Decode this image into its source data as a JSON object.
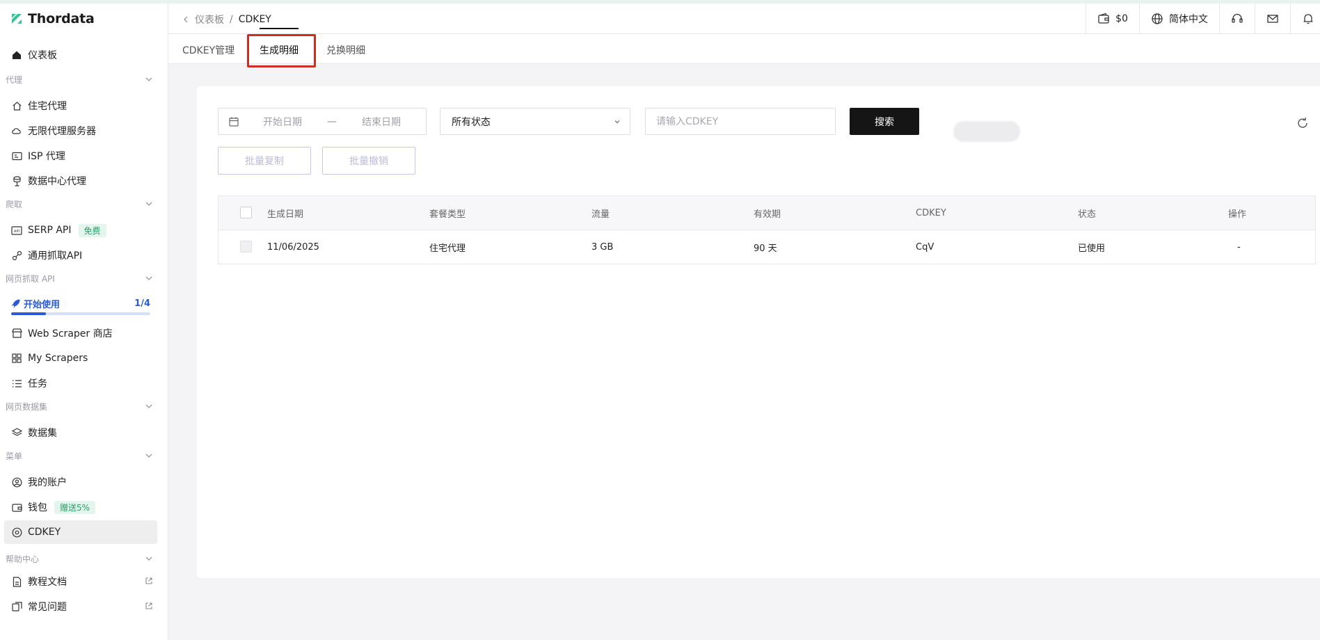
{
  "brand": {
    "name": "Thordata"
  },
  "sidebar": {
    "dashboard": "仪表板",
    "sections": {
      "proxy": "代理",
      "scrape": "爬取",
      "web_scraping_api": "网页抓取 API",
      "web_datasets": "网页数据集",
      "menu": "菜单",
      "help": "帮助中心"
    },
    "items": {
      "residential": "住宅代理",
      "unlimited": "无限代理服务器",
      "isp": "ISP 代理",
      "datacenter": "数据中心代理",
      "serp": "SERP API",
      "serp_badge": "免费",
      "universal": "通用抓取API",
      "store": "Web Scraper 商店",
      "my_scrapers": "My Scrapers",
      "tasks": "任务",
      "dataset": "数据集",
      "account": "我的账户",
      "wallet": "钱包",
      "wallet_badge": "赠送5%",
      "cdkey": "CDKEY",
      "docs": "教程文档",
      "faq": "常见问题"
    },
    "getting_started": {
      "label": "开始使用",
      "progress_text": "1/4",
      "progress": 0.25
    }
  },
  "header": {
    "breadcrumb": [
      "仪表板",
      "CDKEY"
    ],
    "balance": "$0",
    "language": "简体中文"
  },
  "tabs": [
    "CDKEY管理",
    "生成明细",
    "兑换明细"
  ],
  "active_tab": 1,
  "filters": {
    "start_placeholder": "开始日期",
    "separator": "—",
    "end_placeholder": "结束日期",
    "status_selected": "所有状态",
    "cdkey_placeholder": "请输入CDKEY",
    "search_label": "搜索",
    "batch_copy": "批量复制",
    "batch_revoke": "批量撤销"
  },
  "table": {
    "columns": [
      "生成日期",
      "套餐类型",
      "流量",
      "有效期",
      "CDKEY",
      "状态",
      "操作"
    ],
    "rows": [
      [
        "11/06/2025",
        "住宅代理",
        "3 GB",
        "90 天",
        "CqV",
        "已使用",
        "-"
      ]
    ]
  },
  "colors": {
    "accent": "#2a5bd7",
    "highlight": "#cf2e1f",
    "badge_green": "#2a9d6a"
  }
}
